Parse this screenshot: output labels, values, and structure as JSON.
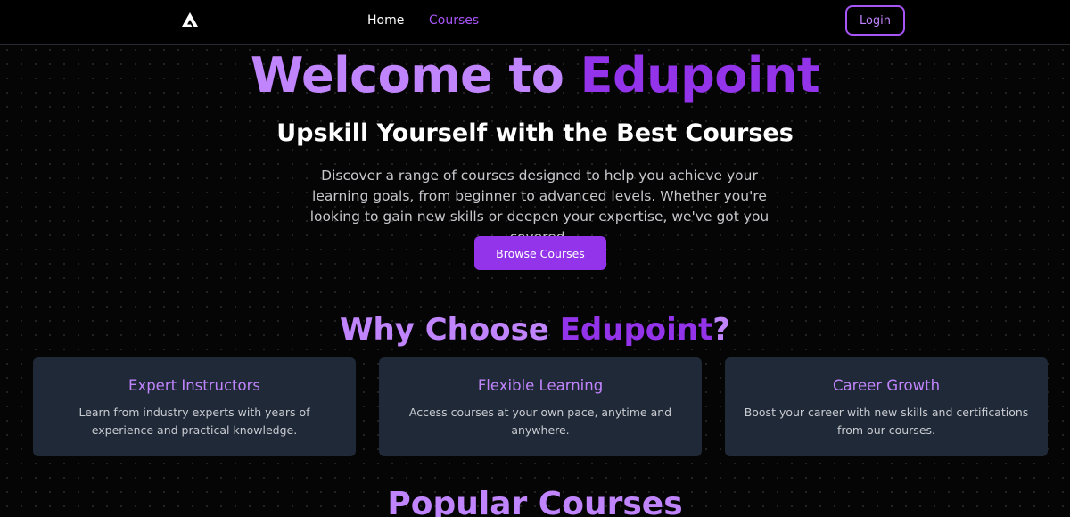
{
  "nav": {
    "logo_icon": "triangle-logo-icon",
    "links": [
      {
        "label": "Home"
      },
      {
        "label": "Courses"
      }
    ],
    "login_label": "Login"
  },
  "hero": {
    "title_part1": "Welcome to ",
    "title_part2": "Edupoint",
    "subtitle": "Upskill Yourself with the Best Courses",
    "description": "Discover a range of courses designed to help you achieve your learning goals, from beginner to advanced levels. Whether you're looking to gain new skills or deepen your expertise, we've got you covered.",
    "cta_label": "Browse Courses"
  },
  "why": {
    "heading_part1": "Why Choose ",
    "heading_part2": "Edupoint",
    "heading_part3": "?",
    "cards": [
      {
        "title": "Expert Instructors",
        "description": "Learn from industry experts with years of experience and practical knowledge."
      },
      {
        "title": "Flexible Learning",
        "description": "Access courses at your own pace, anytime and anywhere."
      },
      {
        "title": "Career Growth",
        "description": "Boost your career with new skills and certifications from our courses."
      }
    ]
  },
  "popular": {
    "heading": "Popular Courses"
  },
  "colors": {
    "accent": "#9333ea",
    "accent_light": "#c084fc",
    "card_bg": "#1f2937",
    "page_bg": "#050505"
  }
}
